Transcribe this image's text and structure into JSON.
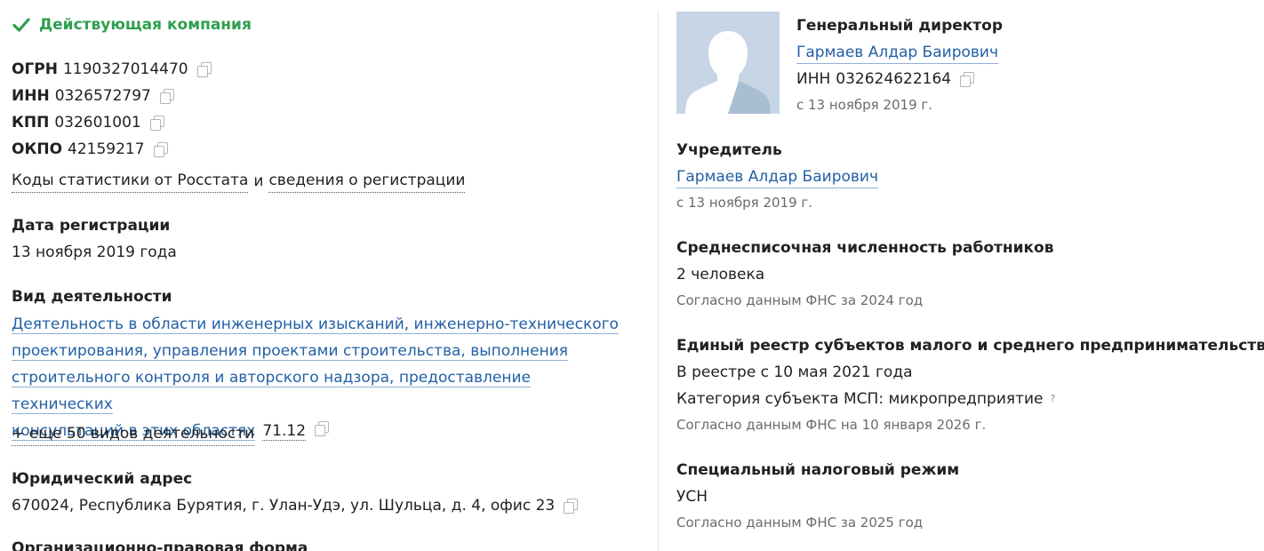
{
  "status": {
    "label": "Действующая компания",
    "color": "#2e9f4f",
    "icon": "check-icon"
  },
  "ids": [
    {
      "label": "ОГРН",
      "value": "1190327014470"
    },
    {
      "label": "ИНН",
      "value": "0326572797"
    },
    {
      "label": "КПП",
      "value": "032601001"
    },
    {
      "label": "ОКПО",
      "value": "42159217"
    }
  ],
  "stats": {
    "link1": "Коды статистики от Росстата",
    "and": "и",
    "link2": "сведения о регистрации"
  },
  "registration": {
    "title": "Дата регистрации",
    "value": "13 ноября 2019 года"
  },
  "activity": {
    "title": "Вид деятельности",
    "lines": [
      "Деятельность в области инженерных изысканий, инженерно-технического",
      "проектирования, управления проектами строительства, выполнения",
      "строительного контроля и авторского надзора, предоставление технических",
      "консультаций в этих областях"
    ],
    "code": "71.12",
    "more": "+ еще 50 видов деятельности"
  },
  "address": {
    "title": "Юридический адрес",
    "value": "670024, Республика Бурятия, г. Улан-Удэ, ул. Шульца, д. 4, офис 23"
  },
  "legal_form": {
    "title": "Организационно-правовая форма"
  },
  "director": {
    "title": "Генеральный директор",
    "name": "Гармаев Алдар Баирович",
    "inn_label": "ИНН",
    "inn": "032624622164",
    "since": "с 13 ноября 2019 г."
  },
  "founder": {
    "title": "Учредитель",
    "name": "Гармаев Алдар Баирович",
    "since": "с 13 ноября 2019 г."
  },
  "employees": {
    "title": "Среднесписочная численность работников",
    "value": "2 человека",
    "source": "Согласно данным ФНС за 2024 год"
  },
  "sme": {
    "title": "Единый реестр субъектов малого и среднего предпринимательства",
    "registry": "В реестре с 10 мая 2021 года",
    "category": "Категория субъекта МСП: микропредприятие",
    "help": "?",
    "source": "Согласно данным ФНС на 10 января 2026 г."
  },
  "tax": {
    "title": "Специальный налоговый режим",
    "value": "УСН",
    "source": "Согласно данным ФНС за 2025 год"
  },
  "colors": {
    "link": "#2360a5",
    "muted": "#6b6b6b",
    "avatar_bg": "#c7d6e6",
    "avatar_fg": "#ffffff"
  }
}
